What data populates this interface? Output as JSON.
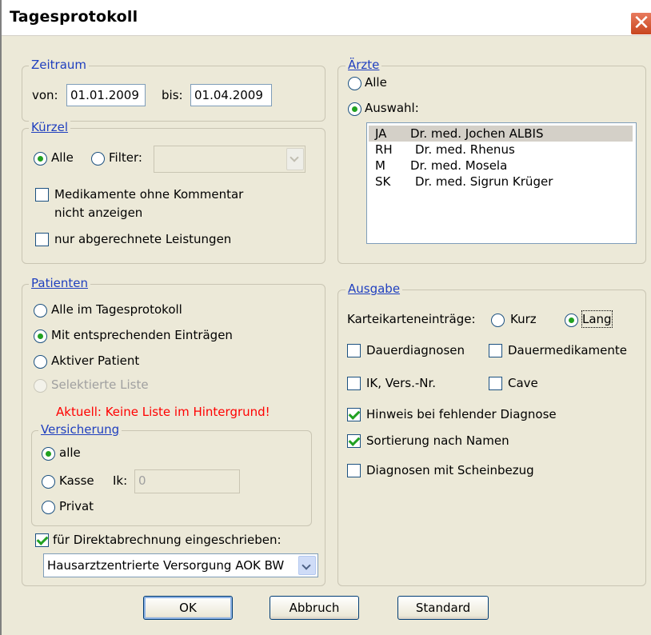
{
  "window": {
    "title": "Tagesprotokoll",
    "close_icon": "close-icon"
  },
  "zeitraum": {
    "legend": "Zeitraum",
    "von_label": "von:",
    "von_value": "01.01.2009",
    "bis_label": "bis:",
    "bis_value": "01.04.2009"
  },
  "kuerzel": {
    "legend": "Kürzel",
    "alle_label": "Alle",
    "alle_selected": true,
    "filter_label": "Filter:",
    "filter_selected": false,
    "filter_value": "",
    "med_label_1": "Medikamente ohne Kommentar",
    "med_label_2": "nicht anzeigen",
    "med_checked": false,
    "abgerechnet_label": "nur abgerechnete Leistungen",
    "abgerechnet_checked": false
  },
  "aerzte": {
    "legend": "Ärzte",
    "alle_label": "Alle",
    "alle_selected": false,
    "auswahl_label": "Auswahl:",
    "auswahl_selected": true,
    "list": [
      {
        "code": "JA",
        "name": "Dr. med. Jochen ALBIS",
        "selected": true
      },
      {
        "code": "RH",
        "name": "Dr. med. Rhenus",
        "selected": false
      },
      {
        "code": "M",
        "name": "Dr. med. Mosela",
        "selected": false
      },
      {
        "code": "SK",
        "name": "Dr. med. Sigrun Krüger",
        "selected": false
      }
    ]
  },
  "patienten": {
    "legend": "Patienten",
    "opt_alle": "Alle im Tagesprotokoll",
    "opt_mit": "Mit entsprechenden Einträgen",
    "opt_aktiv": "Aktiver Patient",
    "opt_liste": "Selektierte Liste",
    "selected": "mit",
    "status_text": "Aktuell: Keine Liste im Hintergrund!",
    "direkt_label": "für Direktabrechnung eingeschrieben:",
    "direkt_checked": true,
    "direkt_value": "Hausarztzentrierte Versorgung AOK BW"
  },
  "versicherung": {
    "legend": "Versicherung",
    "opt_alle": "alle",
    "opt_kasse": "Kasse",
    "opt_privat": "Privat",
    "selected": "alle",
    "ik_label": "Ik:",
    "ik_value": "0"
  },
  "ausgabe": {
    "legend": "Ausgabe",
    "kartei_label": "Karteikarteneinträge:",
    "kurz_label": "Kurz",
    "lang_label": "Lang",
    "kartei_selected": "lang",
    "dauerdiagnosen": "Dauerdiagnosen",
    "dauerdiagnosen_checked": false,
    "dauermedikamente": "Dauermedikamente",
    "dauermedikamente_checked": false,
    "ik_vers": "IK, Vers.-Nr.",
    "ik_vers_checked": false,
    "cave": "Cave",
    "cave_checked": false,
    "hinweis": "Hinweis bei fehlender Diagnose",
    "hinweis_checked": true,
    "sortierung": "Sortierung nach Namen",
    "sortierung_checked": true,
    "diagnosen_schein": "Diagnosen mit Scheinbezug",
    "diagnosen_schein_checked": false
  },
  "buttons": {
    "ok": "OK",
    "abbruch": "Abbruch",
    "standard": "Standard"
  }
}
